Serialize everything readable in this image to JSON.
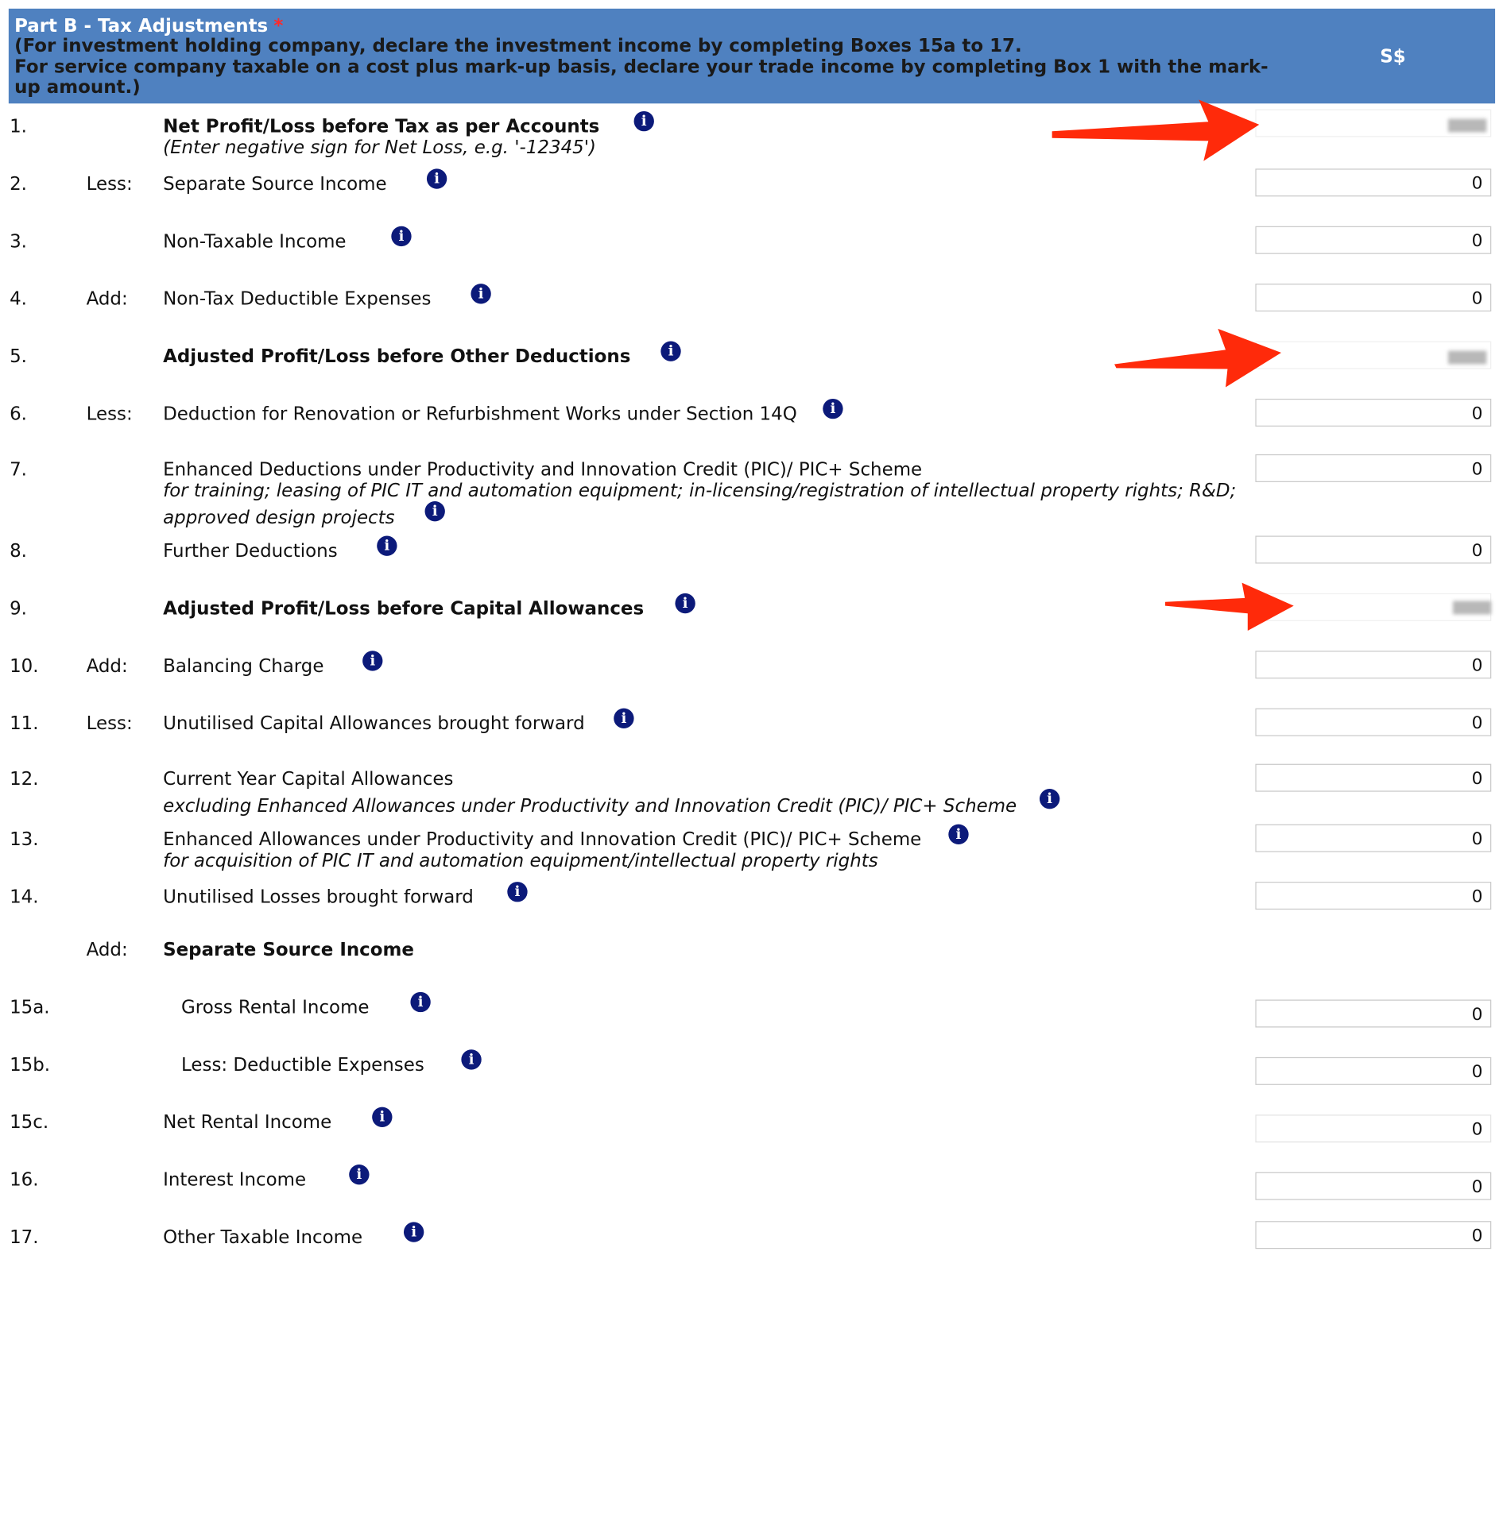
{
  "section": {
    "title": "Part B - Tax Adjustments",
    "required_mark": "*",
    "note": "(For investment holding company, declare the investment income by completing Boxes 15a to 17.\nFor service company taxable on a cost plus mark-up basis, declare your trade income by completing Box 1 with the mark-up amount.)",
    "currency": "S$"
  },
  "rows": [
    {
      "num": "1.",
      "op": "",
      "label": "Net Profit/Loss before Tax as per Accounts",
      "sub": "(Enter negative sign for Net Loss, e.g. '-12345')",
      "value": ""
    },
    {
      "num": "2.",
      "op": "Less:",
      "label": "Separate Source Income",
      "value": "0"
    },
    {
      "num": "3.",
      "op": "",
      "label": "Non-Taxable Income",
      "value": "0"
    },
    {
      "num": "4.",
      "op": "Add:",
      "label": "Non-Tax Deductible Expenses",
      "value": "0"
    },
    {
      "num": "5.",
      "op": "",
      "label": "Adjusted Profit/Loss before Other Deductions",
      "value": ""
    },
    {
      "num": "6.",
      "op": "Less:",
      "label": "Deduction for Renovation or Refurbishment Works under Section 14Q",
      "value": "0"
    },
    {
      "num": "7.",
      "op": "",
      "label": "Enhanced Deductions under Productivity and Innovation Credit (PIC)/ PIC+ Scheme",
      "sub": "for training; leasing of PIC IT and automation equipment; in-licensing/registration of intellectual property rights; R&D;",
      "sub2": "approved design projects",
      "value": "0"
    },
    {
      "num": "8.",
      "op": "",
      "label": "Further Deductions",
      "value": "0"
    },
    {
      "num": "9.",
      "op": "",
      "label": "Adjusted Profit/Loss before Capital Allowances",
      "value": ""
    },
    {
      "num": "10.",
      "op": "Add:",
      "label": "Balancing Charge",
      "value": "0"
    },
    {
      "num": "11.",
      "op": "Less:",
      "label": "Unutilised Capital Allowances brought forward",
      "value": "0"
    },
    {
      "num": "12.",
      "op": "",
      "label": "Current Year Capital Allowances",
      "sub": "excluding Enhanced Allowances under Productivity and Innovation Credit (PIC)/ PIC+ Scheme",
      "value": "0"
    },
    {
      "num": "13.",
      "op": "",
      "label": "Enhanced Allowances under Productivity and Innovation Credit (PIC)/ PIC+ Scheme",
      "sub": "for acquisition of PIC IT and automation equipment/intellectual property rights",
      "value": "0"
    },
    {
      "num": "14.",
      "op": "",
      "label": "Unutilised Losses brought forward",
      "value": "0"
    },
    {
      "num": "",
      "op": "Add:",
      "label": "Separate Source Income"
    },
    {
      "num": "15a.",
      "op": "",
      "label": "Gross Rental Income",
      "value": "0"
    },
    {
      "num": "15b.",
      "op": "",
      "label": "Less: Deductible Expenses",
      "value": "0"
    },
    {
      "num": "15c.",
      "op": "",
      "label": "Net Rental Income",
      "value": "0"
    },
    {
      "num": "16.",
      "op": "",
      "label": "Interest Income",
      "value": "0"
    },
    {
      "num": "17.",
      "op": "",
      "label": "Other Taxable Income",
      "value": "0"
    }
  ],
  "icons": {
    "info": "info-icon",
    "annotation": "red-arrow"
  },
  "colors": {
    "header_bg": "#4f81c0",
    "info_icon": "#0c1a7a",
    "arrow": "#ff2a0a",
    "required": "#ff2a2a"
  }
}
